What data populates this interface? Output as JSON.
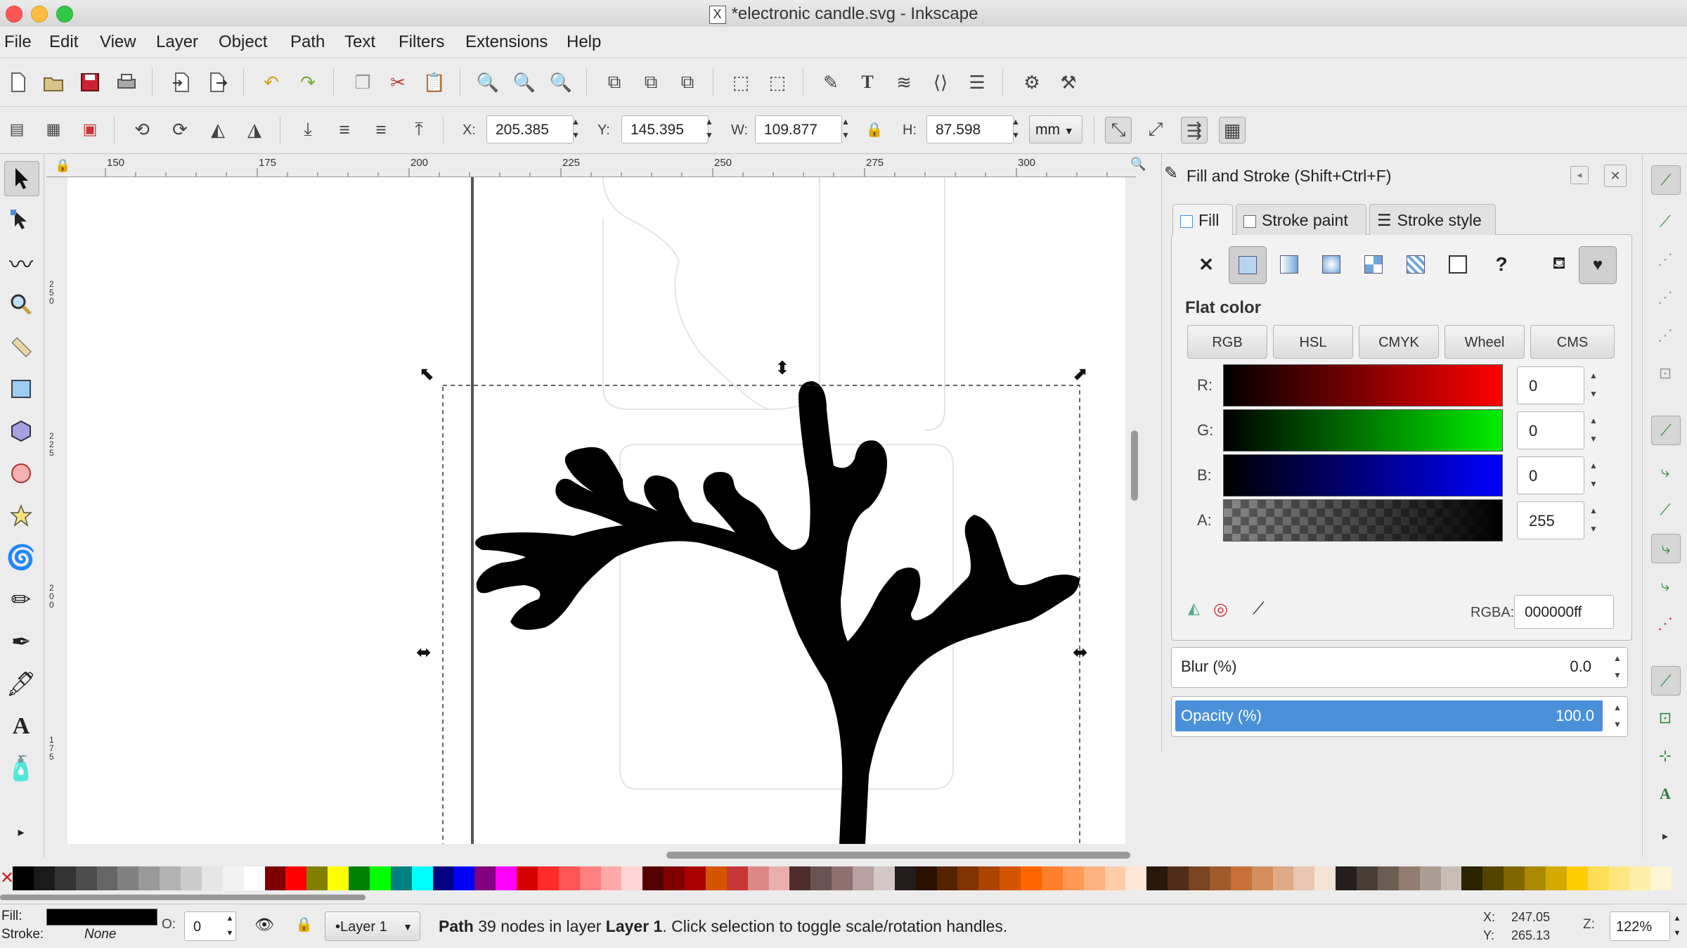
{
  "window": {
    "title": "*electronic candle.svg - Inkscape",
    "x11_badge": "X"
  },
  "menu": [
    "File",
    "Edit",
    "View",
    "Layer",
    "Object",
    "Path",
    "Text",
    "Filters",
    "Extensions",
    "Help"
  ],
  "toolbar": {
    "x_label": "X:",
    "x_value": "205.385",
    "y_label": "Y:",
    "y_value": "145.395",
    "w_label": "W:",
    "w_value": "109.877",
    "h_label": "H:",
    "h_value": "87.598",
    "unit": "mm"
  },
  "ruler": {
    "h_ticks": [
      "150",
      "175",
      "200",
      "225",
      "250",
      "275",
      "300"
    ],
    "v_ticks": [
      "2 5 0",
      "2 2 5",
      "2 0 0",
      "1 7 5"
    ]
  },
  "fill_stroke": {
    "title": "Fill and Stroke (Shift+Ctrl+F)",
    "tabs": [
      "Fill",
      "Stroke paint",
      "Stroke style"
    ],
    "paint_type_unset": "?",
    "mode_heading": "Flat color",
    "modes": [
      "RGB",
      "HSL",
      "CMYK",
      "Wheel",
      "CMS"
    ],
    "channels": [
      {
        "label": "R:",
        "value": "0"
      },
      {
        "label": "G:",
        "value": "0"
      },
      {
        "label": "B:",
        "value": "0"
      },
      {
        "label": "A:",
        "value": "255"
      }
    ],
    "rgba_label": "RGBA:",
    "rgba_value": "000000ff",
    "blur_label": "Blur (%)",
    "blur_value": "0.0",
    "opacity_label": "Opacity (%)",
    "opacity_value": "100.0"
  },
  "colors": {
    "selected_fill": "#000000",
    "accent": "#4a90d9"
  },
  "palette": [
    "#000000",
    "#1a1a1a",
    "#333333",
    "#4d4d4d",
    "#666666",
    "#808080",
    "#999999",
    "#b3b3b3",
    "#cccccc",
    "#e6e6e6",
    "#f2f2f2",
    "#ffffff",
    "#800000",
    "#ff0000",
    "#808000",
    "#ffff00",
    "#008000",
    "#00ff00",
    "#008080",
    "#00ffff",
    "#000080",
    "#0000ff",
    "#800080",
    "#ff00ff",
    "#d40000",
    "#ff2a2a",
    "#ff5555",
    "#ff8080",
    "#ffaaaa",
    "#ffd5d5",
    "#550000",
    "#800000",
    "#aa0000",
    "#d45500",
    "#c83737",
    "#de8787",
    "#e9afaf",
    "#502d2d",
    "#6c5353",
    "#916f6f",
    "#b7a1a1",
    "#d4c7c7",
    "#241c1c",
    "#2b1100",
    "#552200",
    "#803300",
    "#aa4400",
    "#d45500",
    "#ff6600",
    "#ff7f2a",
    "#ff9955",
    "#ffb380",
    "#ffccaa",
    "#ffe6d5",
    "#28170b",
    "#502d16",
    "#784421",
    "#a05a2c",
    "#c87137",
    "#d38d5f",
    "#deaa87",
    "#e9c6af",
    "#f4e3d7",
    "#241f1c",
    "#483e37",
    "#6c5d53",
    "#917c6f",
    "#ac9d93",
    "#c8beb7",
    "#2b2200",
    "#554400",
    "#806600",
    "#aa8800",
    "#d4aa00",
    "#ffcc00",
    "#ffdd55",
    "#ffe680",
    "#ffeeaa",
    "#fff6d5"
  ],
  "status": {
    "fill_label": "Fill:",
    "stroke_label": "Stroke:",
    "stroke_value": "None",
    "opacity_label": "O:",
    "opacity_value": "0",
    "layer": "•Layer 1",
    "message_bold": "Path",
    "message_mid": " 39 nodes in layer ",
    "message_layer": "Layer 1",
    "message_end": ". Click selection to toggle scale/rotation handles.",
    "cursor_x": "247.05",
    "cursor_y": "265.13",
    "cursor_x_label": "X:",
    "cursor_y_label": "Y:",
    "zoom_label": "Z:",
    "zoom": "122%"
  }
}
